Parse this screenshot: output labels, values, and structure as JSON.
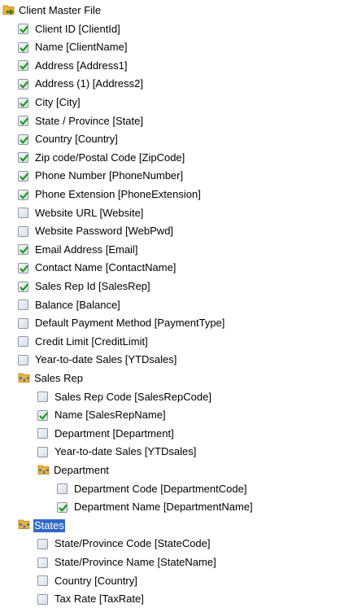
{
  "tree": {
    "root": {
      "label": "Client Master File"
    },
    "client_fields": [
      {
        "label": "Client ID  [ClientId]",
        "checked": true
      },
      {
        "label": "Name  [ClientName]",
        "checked": true
      },
      {
        "label": "Address  [Address1]",
        "checked": true
      },
      {
        "label": "Address (1)  [Address2]",
        "checked": true
      },
      {
        "label": "City  [City]",
        "checked": true
      },
      {
        "label": "State / Province  [State]",
        "checked": true
      },
      {
        "label": "Country  [Country]",
        "checked": true
      },
      {
        "label": "Zip code/Postal Code  [ZipCode]",
        "checked": true
      },
      {
        "label": "Phone Number  [PhoneNumber]",
        "checked": true
      },
      {
        "label": "Phone Extension  [PhoneExtension]",
        "checked": true
      },
      {
        "label": "Website URL  [Website]",
        "checked": false
      },
      {
        "label": "Website Password  [WebPwd]",
        "checked": false
      },
      {
        "label": "Email Address  [Email]",
        "checked": true
      },
      {
        "label": "Contact Name  [ContactName]",
        "checked": true
      },
      {
        "label": "Sales Rep Id  [SalesRep]",
        "checked": true
      },
      {
        "label": "Balance  [Balance]",
        "checked": false
      },
      {
        "label": "Default Payment Method  [PaymentType]",
        "checked": false
      },
      {
        "label": "Credit Limit  [CreditLimit]",
        "checked": false
      },
      {
        "label": "Year-to-date Sales  [YTDsales]",
        "checked": false
      }
    ],
    "sales_rep": {
      "label": "Sales Rep",
      "fields": [
        {
          "label": "Sales Rep Code  [SalesRepCode]",
          "checked": false
        },
        {
          "label": "Name  [SalesRepName]",
          "checked": true
        },
        {
          "label": "Department  [Department]",
          "checked": false
        },
        {
          "label": "Year-to-date Sales  [YTDsales]",
          "checked": false
        }
      ],
      "department": {
        "label": "Department",
        "fields": [
          {
            "label": "Department Code  [DepartmentCode]",
            "checked": false
          },
          {
            "label": "Department Name  [DepartmentName]",
            "checked": true
          }
        ]
      }
    },
    "states": {
      "label": "States",
      "selected": true,
      "fields": [
        {
          "label": "State/Province Code  [StateCode]",
          "checked": false
        },
        {
          "label": "State/Province Name  [StateName]",
          "checked": false
        },
        {
          "label": "Country  [Country]",
          "checked": false
        },
        {
          "label": "Tax Rate  [TaxRate]",
          "checked": false
        }
      ]
    }
  },
  "colors": {
    "check": "#1f9a1f",
    "selection": "#3169c6",
    "folder": "#f2b330"
  }
}
